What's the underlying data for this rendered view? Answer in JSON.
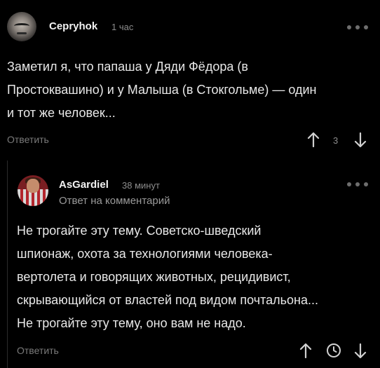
{
  "comment": {
    "username": "Cepryhok",
    "time": "1 час",
    "text_lines": [
      "Заметил я, что папаша у Дяди Фёдора (в",
      "Простоквашино) и у Малыша (в Стокгольме) — один",
      "и тот же человек..."
    ],
    "reply_label": "Ответить",
    "rating": "3"
  },
  "reply": {
    "username": "AsGardiel",
    "time": "38 минут",
    "reply_to": "Ответ на комментарий",
    "text_lines": [
      "Не трогайте эту тему. Советско-шведский",
      "шпионаж, охота за технологиями человека-",
      "вертолета и говорящих животных, рецидивист,",
      "скрывающийся от властей под видом почтальона...",
      "Не трогайте эту тему, оно вам не надо."
    ],
    "reply_label": "Ответить"
  },
  "icons": {
    "more": "more-dots-icon",
    "upvote": "arrow-up-icon",
    "downvote": "arrow-down-icon",
    "history": "clock-history-icon"
  },
  "colors": {
    "background": "#000000",
    "text": "#e8e8e8",
    "muted": "#7a7a7a"
  }
}
